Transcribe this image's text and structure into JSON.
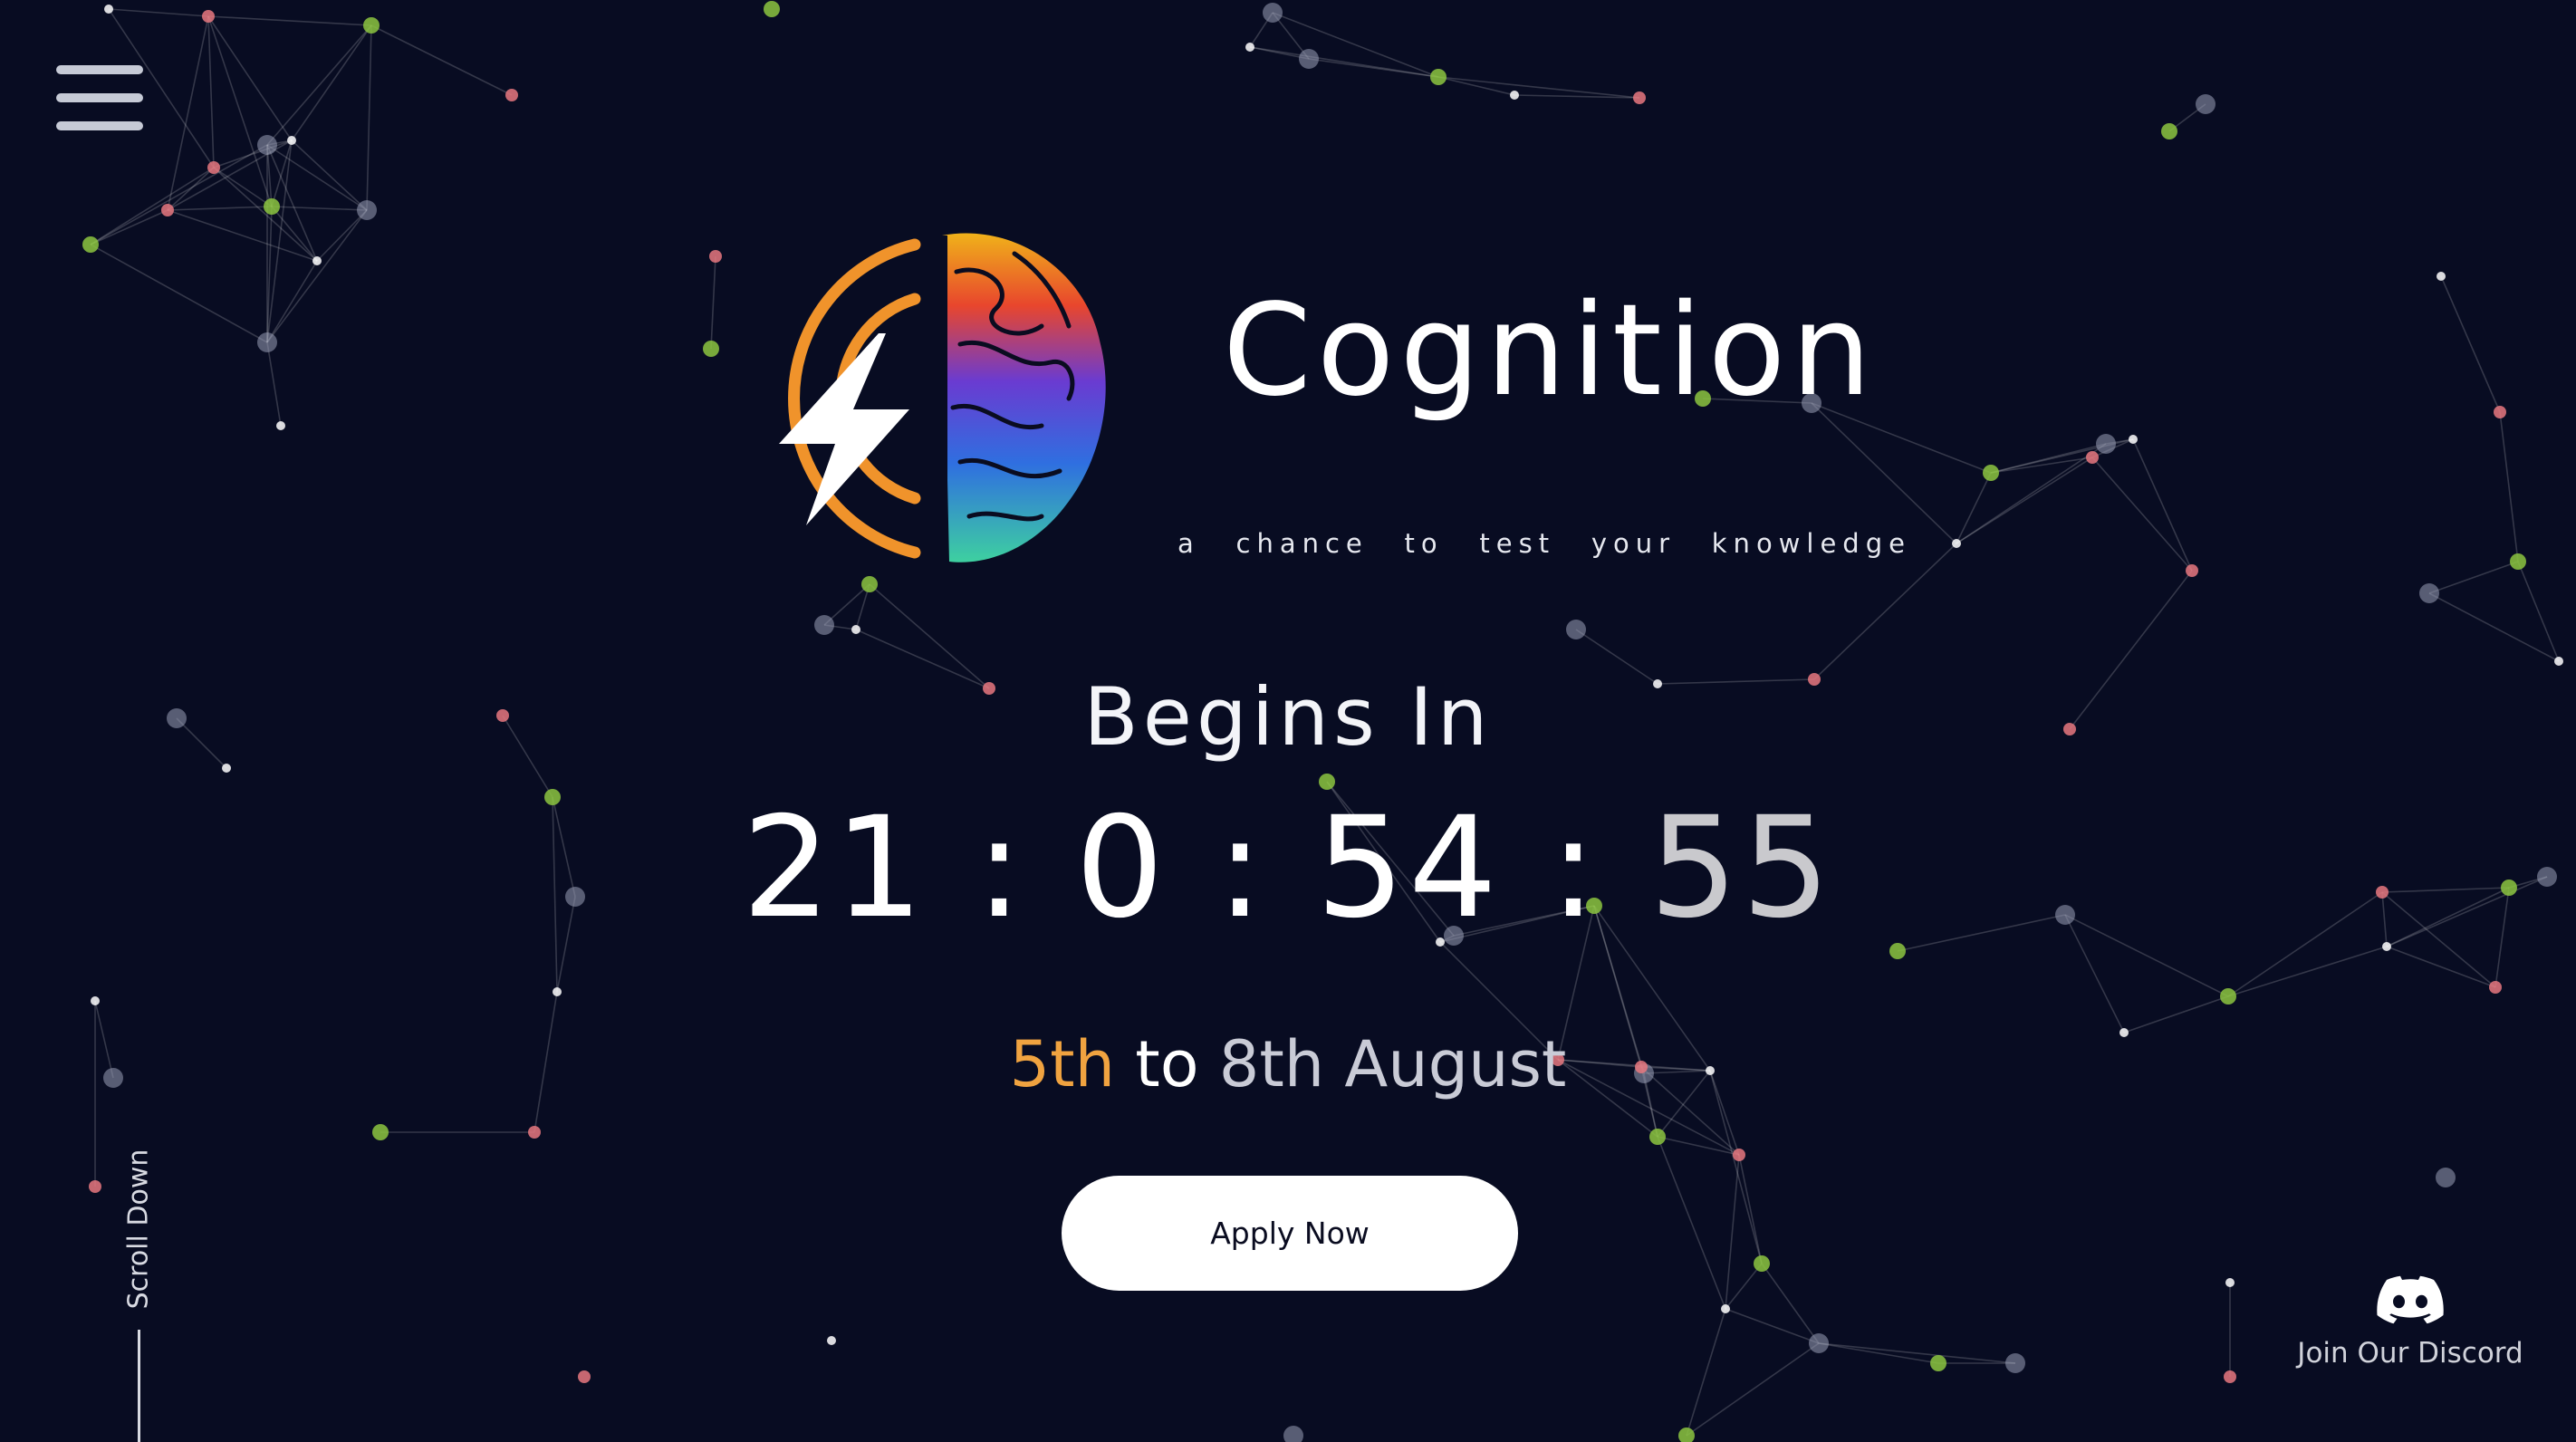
{
  "menu": {
    "icon": "hamburger-menu-icon"
  },
  "hero": {
    "logo": "cognition-logo-lightning-brain",
    "title": "Cognition",
    "tagline_words": [
      "a",
      "chance",
      "to",
      "test",
      "your",
      "knowledge"
    ]
  },
  "countdown": {
    "heading": "Begins In",
    "days": "21",
    "hours": "0",
    "minutes": "54",
    "seconds": "55",
    "separator": ":"
  },
  "dates": {
    "start": "5th",
    "connector": "to",
    "end": "8th August"
  },
  "cta": {
    "apply_label": "Apply Now"
  },
  "scroll": {
    "label": "Scroll Down"
  },
  "discord": {
    "icon": "discord-icon",
    "label": "Join Our Discord"
  },
  "colors": {
    "background": "#080c22",
    "accent_orange": "#f0a340",
    "node_pink": "#e8787f",
    "node_green": "#8cc63f",
    "node_white": "#ffffff"
  }
}
